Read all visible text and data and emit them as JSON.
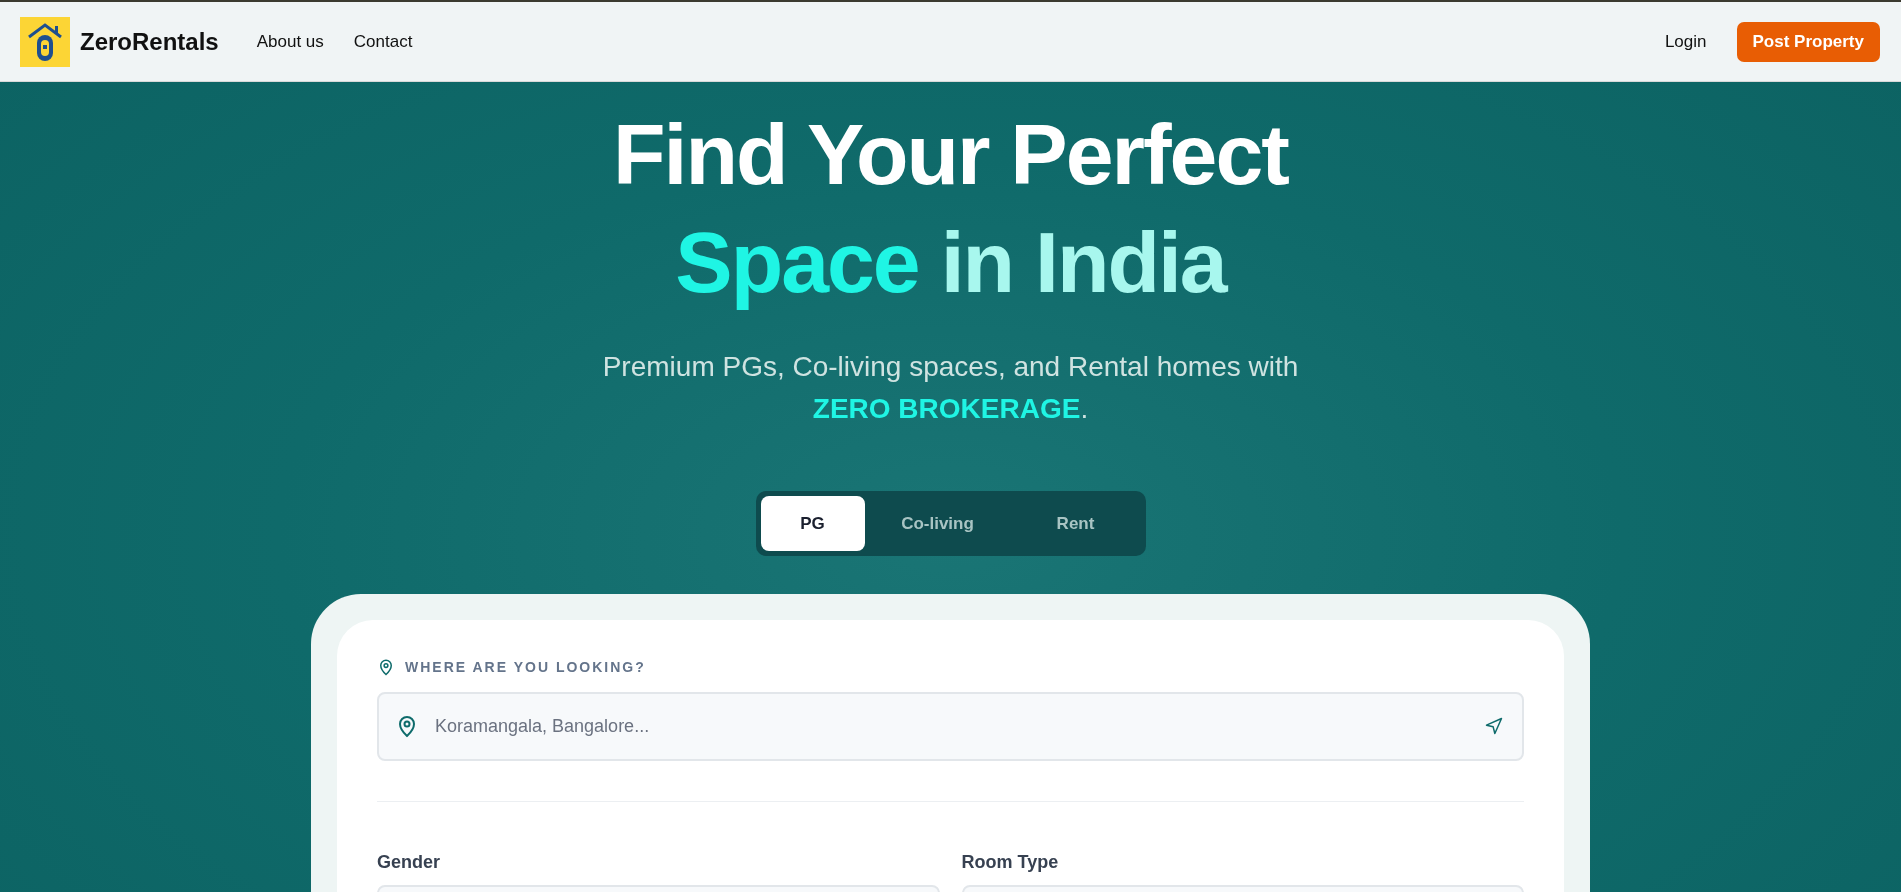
{
  "header": {
    "brand": "ZeroRentals",
    "nav": [
      "About us",
      "Contact"
    ],
    "login": "Login",
    "cta": "Post Property"
  },
  "hero": {
    "title_line1": "Find Your Perfect",
    "title_accent": "Space",
    "title_rest": "in India",
    "subtitle": "Premium PGs, Co-living spaces, and Rental homes with",
    "subtitle_highlight": "ZERO BROKERAGE",
    "subtitle_end": "."
  },
  "tabs": [
    {
      "label": "PG",
      "selected": true
    },
    {
      "label": "Co-living",
      "selected": false
    },
    {
      "label": "Rent",
      "selected": false
    }
  ],
  "search": {
    "label": "WHERE ARE YOU LOOKING?",
    "placeholder": "Koramangala, Bangalore..."
  },
  "filters": [
    {
      "label": "Gender"
    },
    {
      "label": "Room Type"
    }
  ]
}
